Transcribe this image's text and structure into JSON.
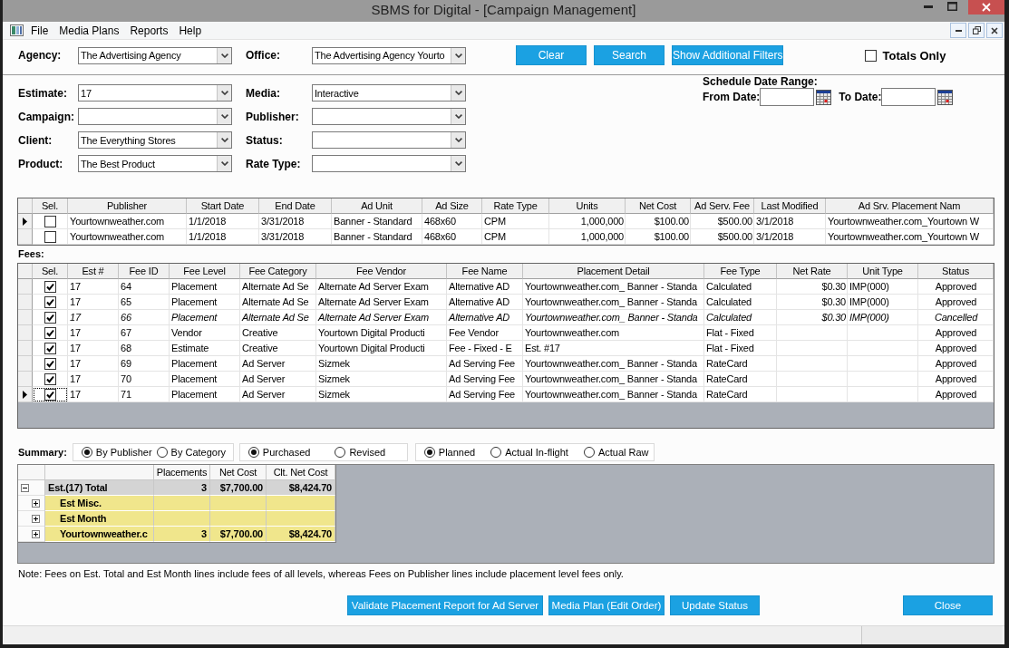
{
  "window": {
    "title": "SBMS for Digital - [Campaign Management]"
  },
  "menu": [
    "File",
    "Media Plans",
    "Reports",
    "Help"
  ],
  "filters": {
    "top": [
      {
        "label": "Agency:",
        "value": "The Advertising Agency"
      },
      {
        "label": "Office:",
        "value": "The Advertising Agency Yourto"
      }
    ],
    "buttons": [
      "Clear",
      "Search",
      "Show Additional Filters"
    ],
    "totals_only": {
      "label": "Totals Only",
      "checked": false
    },
    "left": [
      {
        "label": "Estimate:",
        "value": "17"
      },
      {
        "label": "Campaign:"
      },
      {
        "label": "Client:",
        "value": "The Everything Stores"
      },
      {
        "label": "Product:",
        "value": "The Best Product"
      }
    ],
    "right": [
      {
        "label": "Media:",
        "value": "Interactive"
      },
      {
        "label": "Publisher:"
      },
      {
        "label": "Status:"
      },
      {
        "label": "Rate Type:"
      }
    ],
    "date_range": {
      "title": "Schedule Date Range:",
      "from_label": "From Date:",
      "to_label": "To Date:"
    }
  },
  "placements": {
    "columns": [
      "Sel.",
      "Publisher",
      "Start Date",
      "End Date",
      "Ad Unit",
      "Ad Size",
      "Rate Type",
      "Units",
      "Net Cost",
      "Ad Serv. Fee",
      "Last Modified",
      "Ad Srv. Placement Nam"
    ],
    "rows": [
      {
        "current": true,
        "checked": false,
        "publisher": "Yourtownweather.com",
        "start_date": "1/1/2018",
        "end_date": "3/31/2018",
        "ad_unit": "Banner - Standard",
        "ad_size": "468x60",
        "rate_type": "CPM",
        "units": "1,000,000",
        "net_cost": "$100.00",
        "ad_serv_fee": "$500.00",
        "last_modified": "3/1/2018",
        "ad_srv_placement_name": "Yourtownweather.com_Yourtown W"
      },
      {
        "current": false,
        "checked": false,
        "publisher": "Yourtownweather.com",
        "start_date": "1/1/2018",
        "end_date": "3/31/2018",
        "ad_unit": "Banner - Standard",
        "ad_size": "468x60",
        "rate_type": "CPM",
        "units": "1,000,000",
        "net_cost": "$100.00",
        "ad_serv_fee": "$500.00",
        "last_modified": "3/1/2018",
        "ad_srv_placement_name": "Yourtownweather.com_Yourtown W"
      }
    ]
  },
  "fees": {
    "label": "Fees:",
    "columns": [
      "Sel.",
      "Est #",
      "Fee ID",
      "Fee Level",
      "Fee Category",
      "Fee Vendor",
      "Fee Name",
      "Placement Detail",
      "Fee Type",
      "Net Rate",
      "Unit Type",
      "Status"
    ],
    "rows": [
      {
        "current": false,
        "checked": true,
        "cancelled": false,
        "est": "17",
        "fee_id": "64",
        "fee_level": "Placement",
        "fee_category": "Alternate Ad Se",
        "fee_vendor": "Alternate Ad Server Exam",
        "fee_name": "Alternative AD",
        "placement_detail": "Yourtownweather.com_ Banner - Standa",
        "fee_type": "Calculated",
        "net_rate": "$0.30",
        "unit_type": "IMP(000)",
        "status": "Approved"
      },
      {
        "current": false,
        "checked": true,
        "cancelled": false,
        "est": "17",
        "fee_id": "65",
        "fee_level": "Placement",
        "fee_category": "Alternate Ad Se",
        "fee_vendor": "Alternate Ad Server Exam",
        "fee_name": "Alternative AD",
        "placement_detail": "Yourtownweather.com_ Banner - Standa",
        "fee_type": "Calculated",
        "net_rate": "$0.30",
        "unit_type": "IMP(000)",
        "status": "Approved"
      },
      {
        "current": false,
        "checked": true,
        "cancelled": true,
        "est": "17",
        "fee_id": "66",
        "fee_level": "Placement",
        "fee_category": "Alternate Ad Se",
        "fee_vendor": "Alternate Ad Server Exam",
        "fee_name": "Alternative AD",
        "placement_detail": "Yourtownweather.com_ Banner - Standa",
        "fee_type": "Calculated",
        "net_rate": "$0.30",
        "unit_type": "IMP(000)",
        "status": "Cancelled"
      },
      {
        "current": false,
        "checked": true,
        "cancelled": false,
        "est": "17",
        "fee_id": "67",
        "fee_level": "Vendor",
        "fee_category": "Creative",
        "fee_vendor": "Yourtown Digital Producti",
        "fee_name": "Fee Vendor",
        "placement_detail": "Yourtownweather.com",
        "fee_type": "Flat - Fixed",
        "status": "Approved"
      },
      {
        "current": false,
        "checked": true,
        "cancelled": false,
        "est": "17",
        "fee_id": "68",
        "fee_level": "Estimate",
        "fee_category": "Creative",
        "fee_vendor": "Yourtown Digital Producti",
        "fee_name": "Fee - Fixed - E",
        "placement_detail": "Est. #17",
        "fee_type": "Flat - Fixed",
        "status": "Approved"
      },
      {
        "current": false,
        "checked": true,
        "cancelled": false,
        "est": "17",
        "fee_id": "69",
        "fee_level": "Placement",
        "fee_category": "Ad Server",
        "fee_vendor": "Sizmek",
        "fee_name": "Ad Serving Fee",
        "placement_detail": "Yourtownweather.com_ Banner - Standa",
        "fee_type": "RateCard",
        "status": "Approved"
      },
      {
        "current": false,
        "checked": true,
        "cancelled": false,
        "est": "17",
        "fee_id": "70",
        "fee_level": "Placement",
        "fee_category": "Ad Server",
        "fee_vendor": "Sizmek",
        "fee_name": "Ad Serving Fee",
        "placement_detail": "Yourtownweather.com_ Banner - Standa",
        "fee_type": "RateCard",
        "status": "Approved"
      },
      {
        "current": true,
        "checked": true,
        "cancelled": false,
        "est": "17",
        "fee_id": "71",
        "fee_level": "Placement",
        "fee_category": "Ad Server",
        "fee_vendor": "Sizmek",
        "fee_name": "Ad Serving Fee",
        "placement_detail": "Yourtownweather.com_ Banner - Standa",
        "fee_type": "RateCard",
        "status": "Approved"
      }
    ]
  },
  "summary": {
    "label": "Summary:",
    "groups": [
      {
        "options": [
          {
            "label": "By Publisher",
            "selected": true
          },
          {
            "label": "By Category",
            "selected": false
          }
        ]
      },
      {
        "options": [
          {
            "label": "Purchased",
            "selected": true
          },
          {
            "label": "Revised",
            "selected": false
          }
        ]
      },
      {
        "options": [
          {
            "label": "Planned",
            "selected": true
          },
          {
            "label": "Actual In-flight",
            "selected": false
          },
          {
            "label": "Actual Raw",
            "selected": false
          }
        ]
      }
    ],
    "pivot": {
      "columns": [
        "Placements",
        "Net Cost",
        "Clt. Net Cost"
      ],
      "rows": [
        {
          "kind": "total",
          "label": "Est.(17) Total",
          "expanded": true,
          "placements": "3",
          "net_cost": "$7,700.00",
          "clt_net_cost": "$8,424.70"
        },
        {
          "kind": "group",
          "label": "Est Misc.",
          "expanded": false
        },
        {
          "kind": "group",
          "label": "Est Month",
          "expanded": false
        },
        {
          "kind": "group",
          "label": "Yourtownweather.c",
          "expanded": false,
          "placements": "3",
          "net_cost": "$7,700.00",
          "clt_net_cost": "$8,424.70"
        }
      ]
    }
  },
  "note": "Note: Fees on Est. Total and Est Month lines include fees of all levels, whereas Fees on Publisher lines include placement level fees only.",
  "actions": [
    "Validate Placement Report for Ad Server",
    "Media Plan (Edit Order)",
    "Update Status"
  ],
  "close_button": "Close"
}
